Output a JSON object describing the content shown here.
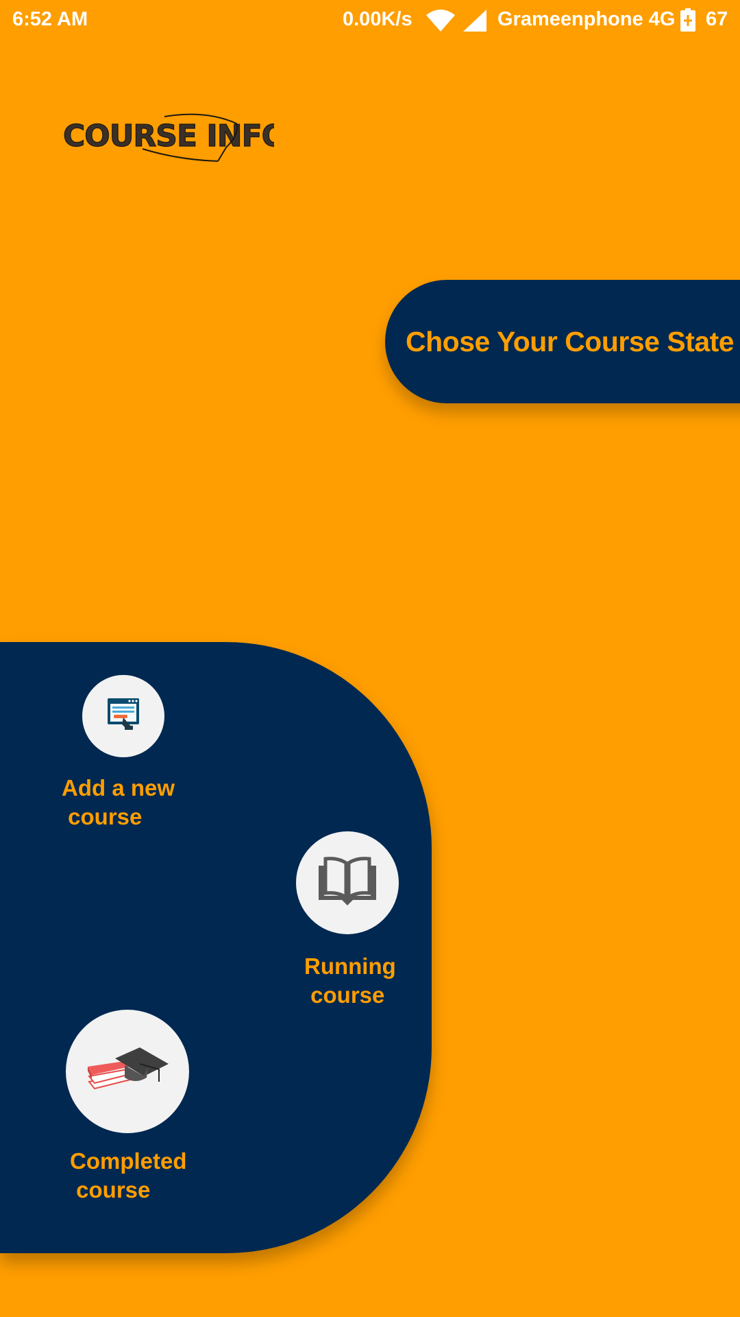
{
  "status_bar": {
    "time": "6:52 AM",
    "net_speed": "0.00K/s",
    "carrier": "Grameenphone 4G",
    "battery": "67",
    "icons": [
      "wifi-icon",
      "signal-icon",
      "battery-charging-icon"
    ]
  },
  "logo": {
    "text": "COURSE INFO"
  },
  "state_prompt": {
    "label": "Chose Your Course State"
  },
  "menu": {
    "items": [
      {
        "label": "Add a new\n course",
        "icon": "add-course-icon"
      },
      {
        "label": "Running\n course",
        "icon": "open-book-icon"
      },
      {
        "label": "Completed\n course",
        "icon": "graduation-books-icon"
      }
    ]
  },
  "colors": {
    "background": "#FF9E00",
    "panel": "#002851",
    "accent_text": "#FF9E00",
    "circle": "#F2F2F2"
  }
}
